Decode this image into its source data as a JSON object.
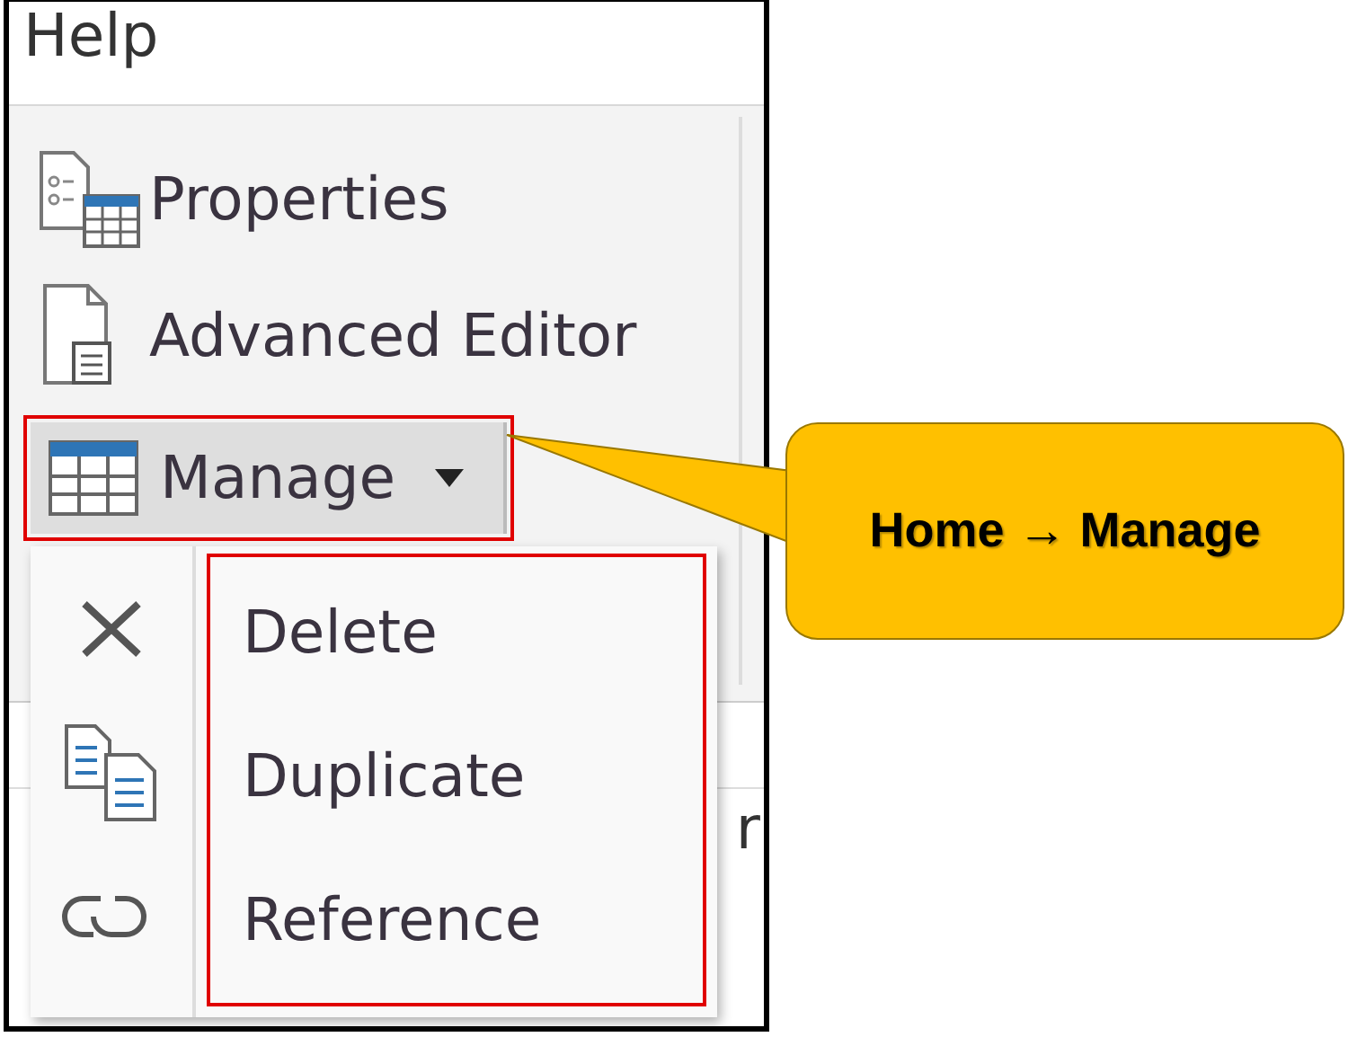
{
  "ribbon": {
    "tab": "Help",
    "buttons": [
      {
        "label": "Properties",
        "kind": "properties"
      },
      {
        "label": "Advanced Editor",
        "kind": "editor"
      },
      {
        "label": "Manage",
        "kind": "manage",
        "expanded": true
      }
    ]
  },
  "dropdown": {
    "items": [
      {
        "label": "Delete",
        "kind": "delete"
      },
      {
        "label": "Duplicate",
        "kind": "duplicate"
      },
      {
        "label": "Reference",
        "kind": "reference"
      }
    ]
  },
  "background_fragments": [
    "r"
  ],
  "callout": {
    "text": "Home → Manage"
  }
}
